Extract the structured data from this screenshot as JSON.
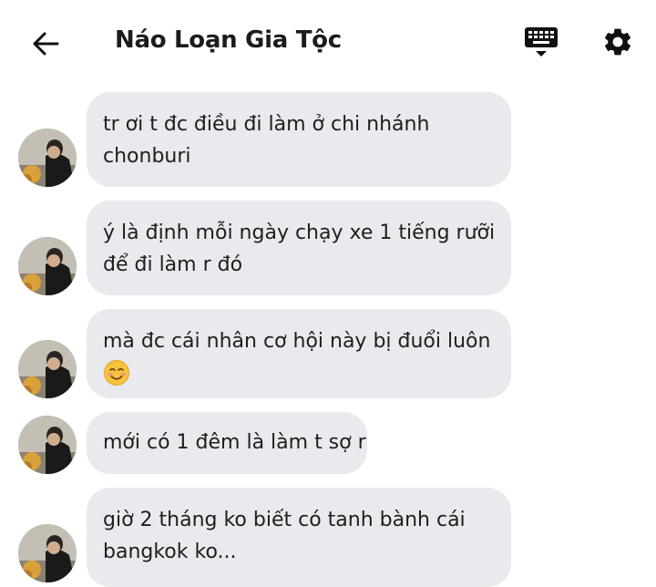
{
  "header": {
    "title": "Náo Loạn Gia Tộc",
    "back_icon": "arrow-left-icon",
    "keyboard_icon": "keyboard-icon",
    "settings_icon": "gear-icon"
  },
  "messages": [
    {
      "lines": [
        "tr ơi t đc điều đi làm ở chi nhánh",
        "chonburi"
      ]
    },
    {
      "lines": [
        "ý là định mỗi ngày chạy xe 1 tiếng rưỡi",
        "để đi làm r đó"
      ]
    },
    {
      "lines": [
        "mà đc cái nhân cơ hội này bị đuổi luôn"
      ],
      "emoji": "smiling-face-emoji"
    },
    {
      "lines": [
        "mới có 1 đêm là làm t sợ r"
      ]
    },
    {
      "lines": [
        "giờ 2 tháng ko biết có tanh bành cái",
        "bangkok ko..."
      ]
    }
  ],
  "colors": {
    "bubble_bg": "#e8eaee",
    "text": "#1e1e1e",
    "background": "#ffffff"
  }
}
